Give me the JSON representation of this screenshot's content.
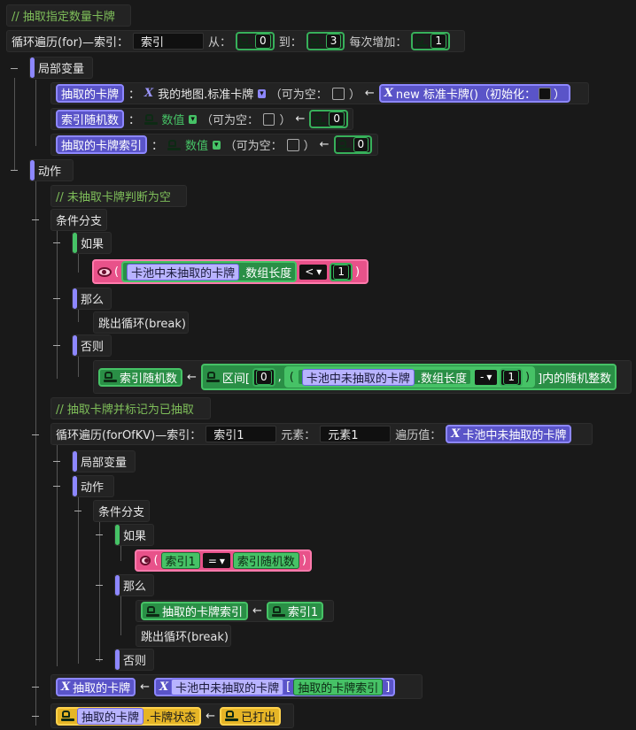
{
  "rows": {
    "comment1": "// 抽取指定数量卡牌",
    "for_label": "循环遍历(for)—索引：",
    "for_index": "索引",
    "from": "从：",
    "from_val": "0",
    "to": "到：",
    "to_val": "3",
    "step": "每次增加：",
    "step_val": "1",
    "locals": "局部变量",
    "var1_name": "抽取的卡牌",
    "var1_type": "我的地图.标准卡牌",
    "nullable": "（可为空：",
    "new_label": "new 标准卡牌()（初始化：",
    "var2_name": "索引随机数",
    "var2_type": "数值",
    "var2_val": "0",
    "var3_name": "抽取的卡牌索引",
    "var3_type": "数值",
    "var3_val": "0",
    "actions": "动作",
    "comment2": "// 未抽取卡牌判断为空",
    "branch": "条件分支",
    "if": "如果",
    "cond1_list": "卡池中未抽取的卡牌",
    "cond1_prop": ".数组长度",
    "cond1_op": "<",
    "cond1_val": "1",
    "then": "那么",
    "break": "跳出循环(break)",
    "else": "否则",
    "assign_target": "索引随机数",
    "range_label": "区间[",
    "range_start": "0",
    "range_list": "卡池中未抽取的卡牌",
    "range_prop": ".数组长度",
    "range_op": "-",
    "range_sub": "1",
    "range_tail": "]内的随机整数",
    "comment3": "// 抽取卡牌并标记为已抽取",
    "forkv_label": "循环遍历(forOfKV)—索引：",
    "forkv_index": "索引1",
    "elem_label": "元素：",
    "elem_val": "元素1",
    "iter_label": "遍历值：",
    "iter_val": "卡池中未抽取的卡牌",
    "inner_locals": "局部变量",
    "inner_actions": "动作",
    "inner_branch": "条件分支",
    "inner_if": "如果",
    "cond2_left": "索引1",
    "cond2_op": "=",
    "cond2_right": "索引随机数",
    "inner_then": "那么",
    "assign2_target": "抽取的卡牌索引",
    "assign2_val": "索引1",
    "inner_break": "跳出循环(break)",
    "inner_else": "否则",
    "assign3_target": "抽取的卡牌",
    "assign3_list": "卡池中未抽取的卡牌",
    "assign3_index": "抽取的卡牌索引",
    "assign4_obj": "抽取的卡牌",
    "assign4_prop": ".卡牌状态",
    "assign4_val": "已打出",
    "arrow": "←",
    "colon": "：",
    "close_paren": "）",
    "paren_open": "(",
    "paren_close": ")",
    "comma": ",",
    "bracket_open": "[",
    "bracket_close": "]"
  },
  "colors": {
    "background": "#191919",
    "block": "#232323",
    "purple_accent": "#8d87ff",
    "green_accent": "#46c266",
    "pink": "#e8528a",
    "yellow": "#e6b526",
    "comment_green": "#7fbf5a"
  }
}
